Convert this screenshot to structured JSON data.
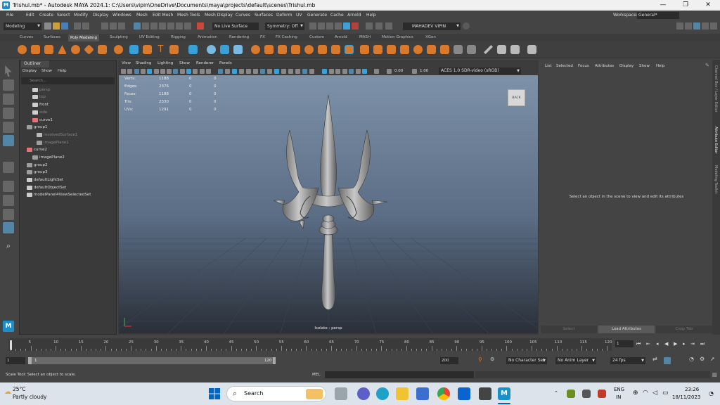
{
  "window": {
    "app_icon_letter": "M",
    "title": "Trishul.mb* - Autodesk MAYA 2024.1: C:\\Users\\vipin\\OneDrive\\Documents\\maya\\projects\\default\\scenes\\Trishul.mb",
    "minimize": "—",
    "maximize": "❐",
    "close": "✕"
  },
  "menubar": {
    "items": [
      "File",
      "Edit",
      "Create",
      "Select",
      "Modify",
      "Display",
      "Windows",
      "Mesh",
      "Edit Mesh",
      "Mesh Tools",
      "Mesh Display",
      "Curves",
      "Surfaces",
      "Deform",
      "UV",
      "Generate",
      "Cache",
      "Arnold",
      "Help"
    ],
    "workspace_label": "Workspace:",
    "workspace_value": "General*"
  },
  "statusline": {
    "mode": "Modeling",
    "live_surface": "No Live Surface",
    "symmetry": "Symmetry: Off",
    "user": "MAHADEV VIPIN"
  },
  "shelf_tabs": {
    "items": [
      "Curves",
      "Surfaces",
      "Poly Modeling",
      "Sculpting",
      "UV Editing",
      "Rigging",
      "Animation",
      "Rendering",
      "FX",
      "FX Caching",
      "Custom",
      "Arnold",
      "MASH",
      "Motion Graphics",
      "XGen"
    ],
    "active": "Poly Modeling"
  },
  "outliner": {
    "tab": "Outliner",
    "menu": [
      "Display",
      "Show",
      "Help"
    ],
    "search_placeholder": "Search...",
    "items": [
      {
        "label": "persp",
        "dim": true,
        "icon": "camera-icon"
      },
      {
        "label": "top",
        "dim": true,
        "icon": "camera-icon"
      },
      {
        "label": "front",
        "dim": false,
        "icon": "camera-icon"
      },
      {
        "label": "side",
        "dim": true,
        "icon": "camera-icon"
      },
      {
        "label": "curve1",
        "dim": false,
        "icon": "curve-icon"
      },
      {
        "label": "group1",
        "dim": false,
        "icon": "group-icon"
      },
      {
        "label": "revolvedSurface1",
        "dim": true,
        "icon": "surface-icon"
      },
      {
        "label": "imagePlane1",
        "dim": true,
        "icon": "image-plane-icon"
      },
      {
        "label": "curve2",
        "dim": false,
        "icon": "curve-icon"
      },
      {
        "label": "imagePlane2",
        "dim": false,
        "icon": "image-plane-icon"
      },
      {
        "label": "group2",
        "dim": false,
        "icon": "group-icon"
      },
      {
        "label": "group3",
        "dim": false,
        "icon": "group-icon"
      },
      {
        "label": "defaultLightSet",
        "dim": false,
        "icon": "set-icon"
      },
      {
        "label": "defaultObjectSet",
        "dim": false,
        "icon": "set-icon"
      },
      {
        "label": "modelPanel4ViewSelectedSet",
        "dim": false,
        "icon": "set-icon"
      }
    ]
  },
  "viewport": {
    "menu": [
      "View",
      "Shading",
      "Lighting",
      "Show",
      "Renderer",
      "Panels"
    ],
    "exposure": "0.00",
    "gamma": "1.00",
    "color_space": "ACES 1.0 SDR-video (sRGB)",
    "hud": [
      {
        "label": "Verts:",
        "v1": "1188",
        "v2": "0",
        "v3": "0"
      },
      {
        "label": "Edges:",
        "v1": "2376",
        "v2": "0",
        "v3": "0"
      },
      {
        "label": "Faces:",
        "v1": "1188",
        "v2": "0",
        "v3": "0"
      },
      {
        "label": "Tris:",
        "v1": "2330",
        "v2": "0",
        "v3": "0"
      },
      {
        "label": "UVs:",
        "v1": "1291",
        "v2": "0",
        "v3": "0"
      }
    ],
    "view_cube": "BACK",
    "camera_label": "Isolate : persp"
  },
  "attribute_editor": {
    "menu": [
      "List",
      "Selected",
      "Focus",
      "Attributes",
      "Display",
      "Show",
      "Help"
    ],
    "message": "Select an object in the scene to view and edit its attributes",
    "buttons": [
      "Select",
      "Load Attributes",
      "Copy Tab"
    ],
    "side_tabs": [
      "Channel Box / Layer Editor",
      "Attribute Editor",
      "Modeling Toolkit"
    ]
  },
  "timeslider": {
    "ticks": [
      "5",
      "10",
      "15",
      "20",
      "25",
      "30",
      "35",
      "40",
      "45",
      "50",
      "55",
      "60",
      "65",
      "70",
      "75",
      "80",
      "85",
      "90",
      "95",
      "100",
      "105",
      "110",
      "115",
      "120"
    ],
    "first_tick": "1",
    "current_frame": "1"
  },
  "rangeslider": {
    "start": "1",
    "inner_start": "1",
    "inner_end": "120",
    "end": "200",
    "character_set": "No Character Set",
    "anim_layer": "No Anim Layer",
    "fps": "24 fps"
  },
  "commandline": {
    "help_text": "Scale Tool: Select an object to scale.",
    "mel": "MEL"
  },
  "taskbar": {
    "temperature": "25°C",
    "weather": "Partly cloudy",
    "search": "Search",
    "language1": "ENG",
    "language2": "IN",
    "time": "23:26",
    "date": "18/11/2023"
  }
}
